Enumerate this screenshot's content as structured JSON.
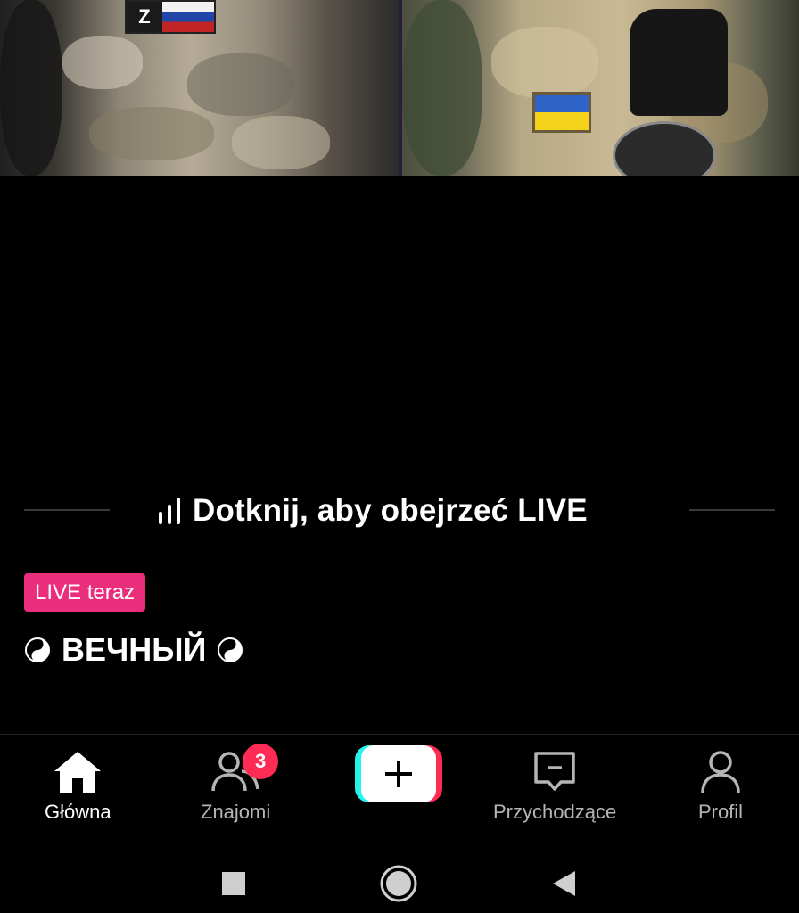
{
  "live_preview": {
    "tap_to_watch": "Dotknij, aby obejrzeć LIVE",
    "badge": "LIVE teraz",
    "streamer_name": "ВЕЧНЫЙ",
    "symbol": "☯",
    "badge_color": "#ea2e7c"
  },
  "video": {
    "left_patch_letter": "Z"
  },
  "bottom_nav": {
    "items": [
      {
        "label": "Główna",
        "icon": "home-icon",
        "active": true
      },
      {
        "label": "Znajomi",
        "icon": "friends-icon",
        "badge": "3"
      },
      {
        "label": "",
        "icon": "plus-icon",
        "create": true
      },
      {
        "label": "Przychodzące",
        "icon": "inbox-icon"
      },
      {
        "label": "Profil",
        "icon": "profile-icon"
      }
    ],
    "accent_cyan": "#25f4ee",
    "accent_red": "#fe2c55"
  },
  "system_nav": {
    "buttons": [
      "recents-button",
      "home-button",
      "back-button"
    ]
  }
}
